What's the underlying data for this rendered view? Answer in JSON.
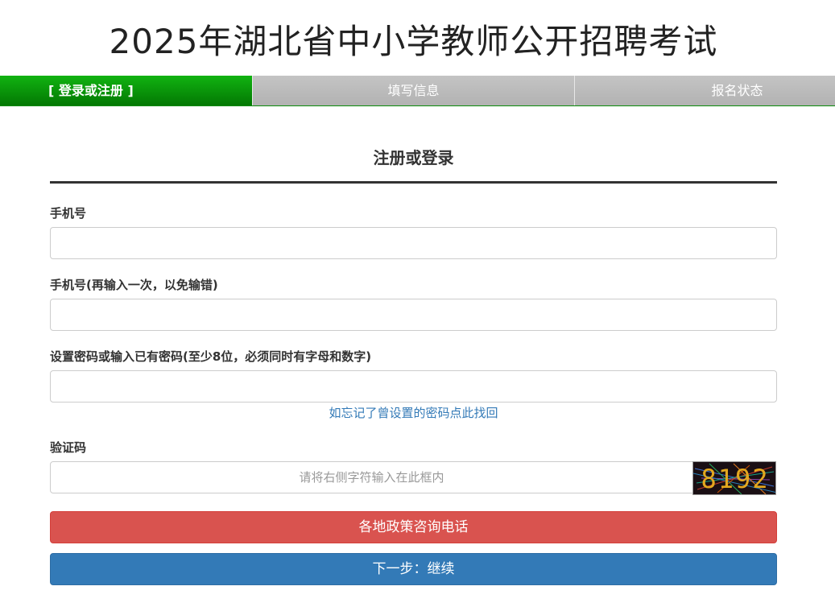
{
  "page": {
    "title": "2025年湖北省中小学教师公开招聘考试"
  },
  "steps": [
    {
      "label": "[ 登录或注册 ]",
      "active": true
    },
    {
      "label": "填写信息",
      "active": false
    },
    {
      "label": "报名状态",
      "active": false
    }
  ],
  "form": {
    "heading": "注册或登录",
    "phone_label": "手机号",
    "phone_value": "",
    "phone_confirm_label": "手机号(再输入一次，以免输错)",
    "phone_confirm_value": "",
    "password_label": "设置密码或输入已有密码(至少8位，必须同时有字母和数字)",
    "password_value": "",
    "forgot_link": "如忘记了曾设置的密码点此找回",
    "captcha_label": "验证码",
    "captcha_placeholder": "请将右侧字符输入在此框内",
    "captcha_value": "",
    "captcha_code": "8192"
  },
  "buttons": {
    "consult": "各地政策咨询电话",
    "next": "下一步：继续"
  },
  "colors": {
    "active_step": "#0a9a0a",
    "inactive_step": "#bbbbbb",
    "consult_button": "#d9534f",
    "next_button": "#337ab7",
    "link": "#337ab7"
  }
}
